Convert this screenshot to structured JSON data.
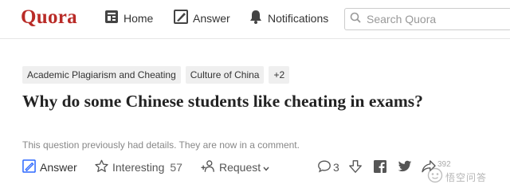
{
  "header": {
    "logo": "Quora",
    "nav": [
      {
        "label": "Home",
        "icon": "home-icon"
      },
      {
        "label": "Answer",
        "icon": "pencil-icon"
      },
      {
        "label": "Notifications",
        "icon": "bell-icon"
      }
    ],
    "search": {
      "placeholder": "Search Quora",
      "value": ""
    }
  },
  "question": {
    "topics": [
      "Academic Plagiarism and Cheating",
      "Culture of China",
      "+2"
    ],
    "title": "Why do some Chinese students like cheating in exams?",
    "details_note": "This question previously had details. They are now in a comment."
  },
  "actions": {
    "answer_label": "Answer",
    "interesting_label": "Interesting",
    "interesting_count": "57",
    "request_label": "Request",
    "comment_count": "3",
    "share_count": "392"
  },
  "watermark": {
    "text": "悟空问答"
  },
  "colors": {
    "brand": "#b92b27",
    "answer_icon": "#2e69ff",
    "text": "#222222",
    "muted": "#888888"
  }
}
